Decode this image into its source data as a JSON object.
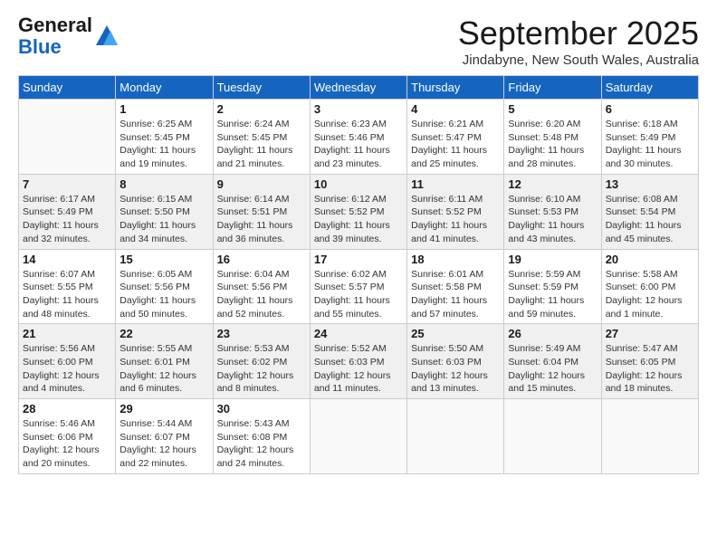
{
  "header": {
    "logo_line1": "General",
    "logo_line2": "Blue",
    "month_title": "September 2025",
    "location": "Jindabyne, New South Wales, Australia"
  },
  "weekdays": [
    "Sunday",
    "Monday",
    "Tuesday",
    "Wednesday",
    "Thursday",
    "Friday",
    "Saturday"
  ],
  "weeks": [
    [
      {
        "day": "",
        "info": ""
      },
      {
        "day": "1",
        "info": "Sunrise: 6:25 AM\nSunset: 5:45 PM\nDaylight: 11 hours\nand 19 minutes."
      },
      {
        "day": "2",
        "info": "Sunrise: 6:24 AM\nSunset: 5:45 PM\nDaylight: 11 hours\nand 21 minutes."
      },
      {
        "day": "3",
        "info": "Sunrise: 6:23 AM\nSunset: 5:46 PM\nDaylight: 11 hours\nand 23 minutes."
      },
      {
        "day": "4",
        "info": "Sunrise: 6:21 AM\nSunset: 5:47 PM\nDaylight: 11 hours\nand 25 minutes."
      },
      {
        "day": "5",
        "info": "Sunrise: 6:20 AM\nSunset: 5:48 PM\nDaylight: 11 hours\nand 28 minutes."
      },
      {
        "day": "6",
        "info": "Sunrise: 6:18 AM\nSunset: 5:49 PM\nDaylight: 11 hours\nand 30 minutes."
      }
    ],
    [
      {
        "day": "7",
        "info": "Sunrise: 6:17 AM\nSunset: 5:49 PM\nDaylight: 11 hours\nand 32 minutes."
      },
      {
        "day": "8",
        "info": "Sunrise: 6:15 AM\nSunset: 5:50 PM\nDaylight: 11 hours\nand 34 minutes."
      },
      {
        "day": "9",
        "info": "Sunrise: 6:14 AM\nSunset: 5:51 PM\nDaylight: 11 hours\nand 36 minutes."
      },
      {
        "day": "10",
        "info": "Sunrise: 6:12 AM\nSunset: 5:52 PM\nDaylight: 11 hours\nand 39 minutes."
      },
      {
        "day": "11",
        "info": "Sunrise: 6:11 AM\nSunset: 5:52 PM\nDaylight: 11 hours\nand 41 minutes."
      },
      {
        "day": "12",
        "info": "Sunrise: 6:10 AM\nSunset: 5:53 PM\nDaylight: 11 hours\nand 43 minutes."
      },
      {
        "day": "13",
        "info": "Sunrise: 6:08 AM\nSunset: 5:54 PM\nDaylight: 11 hours\nand 45 minutes."
      }
    ],
    [
      {
        "day": "14",
        "info": "Sunrise: 6:07 AM\nSunset: 5:55 PM\nDaylight: 11 hours\nand 48 minutes."
      },
      {
        "day": "15",
        "info": "Sunrise: 6:05 AM\nSunset: 5:56 PM\nDaylight: 11 hours\nand 50 minutes."
      },
      {
        "day": "16",
        "info": "Sunrise: 6:04 AM\nSunset: 5:56 PM\nDaylight: 11 hours\nand 52 minutes."
      },
      {
        "day": "17",
        "info": "Sunrise: 6:02 AM\nSunset: 5:57 PM\nDaylight: 11 hours\nand 55 minutes."
      },
      {
        "day": "18",
        "info": "Sunrise: 6:01 AM\nSunset: 5:58 PM\nDaylight: 11 hours\nand 57 minutes."
      },
      {
        "day": "19",
        "info": "Sunrise: 5:59 AM\nSunset: 5:59 PM\nDaylight: 11 hours\nand 59 minutes."
      },
      {
        "day": "20",
        "info": "Sunrise: 5:58 AM\nSunset: 6:00 PM\nDaylight: 12 hours\nand 1 minute."
      }
    ],
    [
      {
        "day": "21",
        "info": "Sunrise: 5:56 AM\nSunset: 6:00 PM\nDaylight: 12 hours\nand 4 minutes."
      },
      {
        "day": "22",
        "info": "Sunrise: 5:55 AM\nSunset: 6:01 PM\nDaylight: 12 hours\nand 6 minutes."
      },
      {
        "day": "23",
        "info": "Sunrise: 5:53 AM\nSunset: 6:02 PM\nDaylight: 12 hours\nand 8 minutes."
      },
      {
        "day": "24",
        "info": "Sunrise: 5:52 AM\nSunset: 6:03 PM\nDaylight: 12 hours\nand 11 minutes."
      },
      {
        "day": "25",
        "info": "Sunrise: 5:50 AM\nSunset: 6:03 PM\nDaylight: 12 hours\nand 13 minutes."
      },
      {
        "day": "26",
        "info": "Sunrise: 5:49 AM\nSunset: 6:04 PM\nDaylight: 12 hours\nand 15 minutes."
      },
      {
        "day": "27",
        "info": "Sunrise: 5:47 AM\nSunset: 6:05 PM\nDaylight: 12 hours\nand 18 minutes."
      }
    ],
    [
      {
        "day": "28",
        "info": "Sunrise: 5:46 AM\nSunset: 6:06 PM\nDaylight: 12 hours\nand 20 minutes."
      },
      {
        "day": "29",
        "info": "Sunrise: 5:44 AM\nSunset: 6:07 PM\nDaylight: 12 hours\nand 22 minutes."
      },
      {
        "day": "30",
        "info": "Sunrise: 5:43 AM\nSunset: 6:08 PM\nDaylight: 12 hours\nand 24 minutes."
      },
      {
        "day": "",
        "info": ""
      },
      {
        "day": "",
        "info": ""
      },
      {
        "day": "",
        "info": ""
      },
      {
        "day": "",
        "info": ""
      }
    ]
  ]
}
